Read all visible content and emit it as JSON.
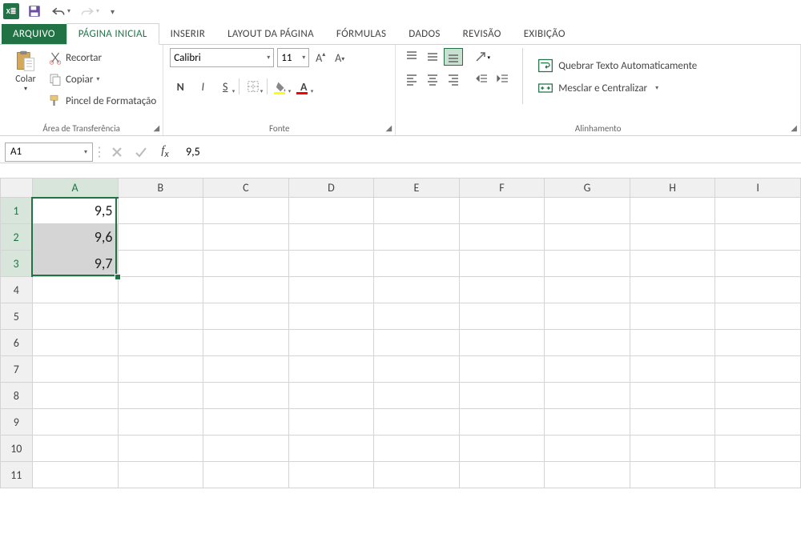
{
  "qat": {
    "app": "X≣"
  },
  "tabs": {
    "file": "ARQUIVO",
    "home": "PÁGINA INICIAL",
    "insert": "INSERIR",
    "page_layout": "LAYOUT DA PÁGINA",
    "formulas": "FÓRMULAS",
    "data": "DADOS",
    "review": "REVISÃO",
    "view": "EXIBIÇÃO"
  },
  "ribbon": {
    "clipboard": {
      "paste": "Colar",
      "cut": "Recortar",
      "copy": "Copiar",
      "painter": "Pincel de Formatação",
      "group_label": "Área de Transferência"
    },
    "font": {
      "name_value": "Calibri",
      "size_value": "11",
      "bold": "N",
      "italic": "I",
      "underline": "S",
      "group_label": "Fonte"
    },
    "align": {
      "wrap": "Quebrar Texto Automaticamente",
      "merge": "Mesclar e Centralizar",
      "group_label": "Alinhamento"
    }
  },
  "formula_bar": {
    "name_box": "A1",
    "value": "9,5"
  },
  "grid": {
    "cols": [
      "A",
      "B",
      "C",
      "D",
      "E",
      "F",
      "G",
      "H",
      "I"
    ],
    "rows": [
      "1",
      "2",
      "3",
      "4",
      "5",
      "6",
      "7",
      "8",
      "9",
      "10",
      "11"
    ],
    "cells": {
      "A1": "9,5",
      "A2": "9,6",
      "A3": "9,7"
    }
  }
}
